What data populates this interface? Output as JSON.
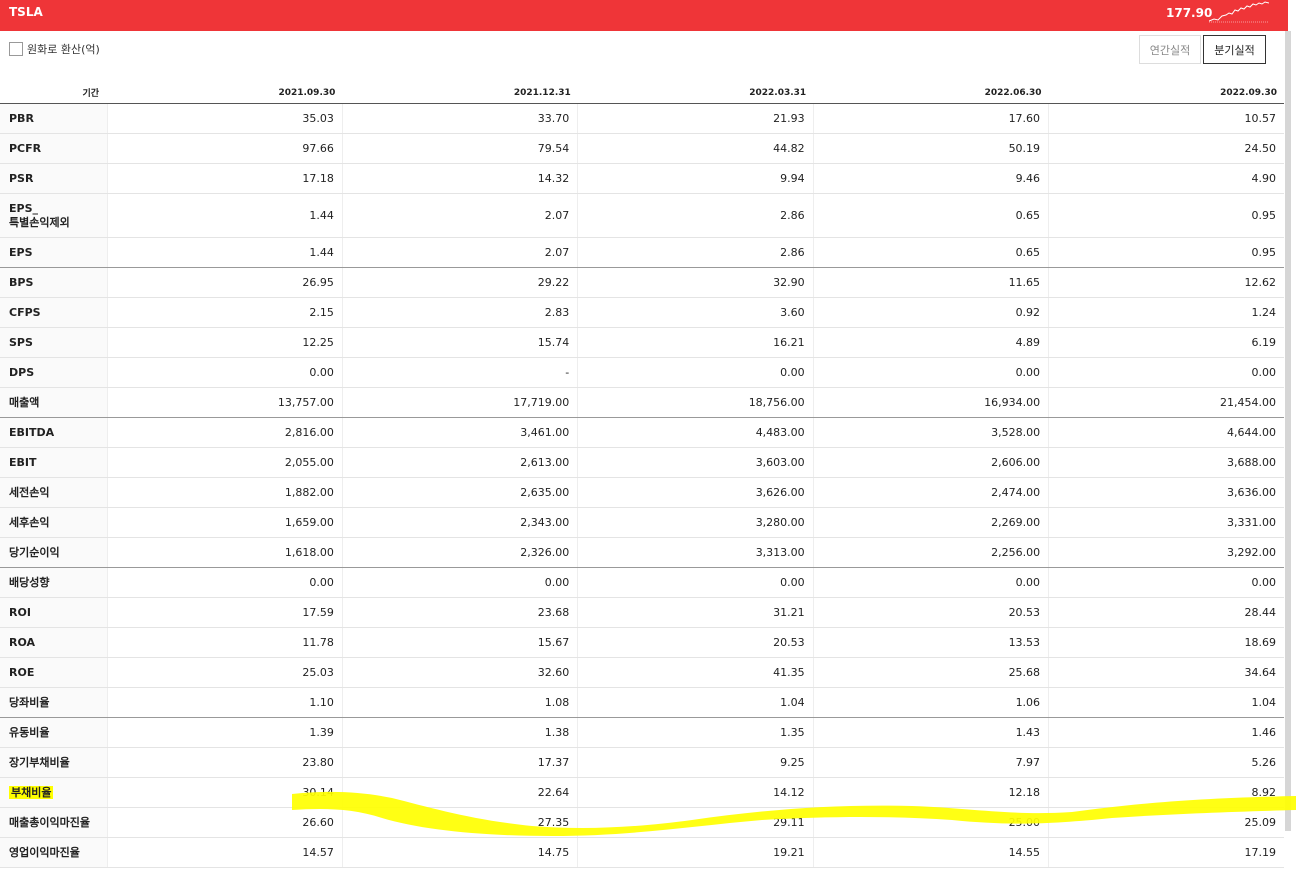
{
  "header": {
    "ticker": "TSLA",
    "price": "177.90"
  },
  "options": {
    "convert_label": "원화로 환산(억)"
  },
  "buttons": {
    "annual": "연간실적",
    "quarterly": "분기실적"
  },
  "colors": {
    "brand_bar": "#ef3538",
    "highlight": "#ffff00"
  },
  "table": {
    "period_label": "기간",
    "periods": [
      "2021.09.30",
      "2021.12.31",
      "2022.03.31",
      "2022.06.30",
      "2022.09.30"
    ],
    "rows": [
      {
        "label": "PBR",
        "values": [
          "35.03",
          "33.70",
          "21.93",
          "17.60",
          "10.57"
        ]
      },
      {
        "label": "PCFR",
        "values": [
          "97.66",
          "79.54",
          "44.82",
          "50.19",
          "24.50"
        ]
      },
      {
        "label": "PSR",
        "values": [
          "17.18",
          "14.32",
          "9.94",
          "9.46",
          "4.90"
        ]
      },
      {
        "label": "EPS_\n특별손익제외",
        "values": [
          "1.44",
          "2.07",
          "2.86",
          "0.65",
          "0.95"
        ]
      },
      {
        "label": "EPS",
        "values": [
          "1.44",
          "2.07",
          "2.86",
          "0.65",
          "0.95"
        ]
      },
      {
        "label": "BPS",
        "values": [
          "26.95",
          "29.22",
          "32.90",
          "11.65",
          "12.62"
        ]
      },
      {
        "label": "CFPS",
        "values": [
          "2.15",
          "2.83",
          "3.60",
          "0.92",
          "1.24"
        ]
      },
      {
        "label": "SPS",
        "values": [
          "12.25",
          "15.74",
          "16.21",
          "4.89",
          "6.19"
        ]
      },
      {
        "label": "DPS",
        "values": [
          "0.00",
          "-",
          "0.00",
          "0.00",
          "0.00"
        ]
      },
      {
        "label": "매출액",
        "values": [
          "13,757.00",
          "17,719.00",
          "18,756.00",
          "16,934.00",
          "21,454.00"
        ]
      },
      {
        "label": "EBITDA",
        "values": [
          "2,816.00",
          "3,461.00",
          "4,483.00",
          "3,528.00",
          "4,644.00"
        ]
      },
      {
        "label": "EBIT",
        "values": [
          "2,055.00",
          "2,613.00",
          "3,603.00",
          "2,606.00",
          "3,688.00"
        ]
      },
      {
        "label": "세전손익",
        "values": [
          "1,882.00",
          "2,635.00",
          "3,626.00",
          "2,474.00",
          "3,636.00"
        ]
      },
      {
        "label": "세후손익",
        "values": [
          "1,659.00",
          "2,343.00",
          "3,280.00",
          "2,269.00",
          "3,331.00"
        ]
      },
      {
        "label": "당기순이익",
        "values": [
          "1,618.00",
          "2,326.00",
          "3,313.00",
          "2,256.00",
          "3,292.00"
        ]
      },
      {
        "label": "배당성향",
        "values": [
          "0.00",
          "0.00",
          "0.00",
          "0.00",
          "0.00"
        ]
      },
      {
        "label": "ROI",
        "values": [
          "17.59",
          "23.68",
          "31.21",
          "20.53",
          "28.44"
        ]
      },
      {
        "label": "ROA",
        "values": [
          "11.78",
          "15.67",
          "20.53",
          "13.53",
          "18.69"
        ]
      },
      {
        "label": "ROE",
        "values": [
          "25.03",
          "32.60",
          "41.35",
          "25.68",
          "34.64"
        ]
      },
      {
        "label": "당좌비율",
        "values": [
          "1.10",
          "1.08",
          "1.04",
          "1.06",
          "1.04"
        ]
      },
      {
        "label": "유동비율",
        "values": [
          "1.39",
          "1.38",
          "1.35",
          "1.43",
          "1.46"
        ]
      },
      {
        "label": "장기부채비율",
        "values": [
          "23.80",
          "17.37",
          "9.25",
          "7.97",
          "5.26"
        ]
      },
      {
        "label": "부채비율",
        "values": [
          "30.14",
          "22.64",
          "14.12",
          "12.18",
          "8.92"
        ]
      },
      {
        "label": "매출총이익마진율",
        "values": [
          "26.60",
          "27.35",
          "29.11",
          "25.00",
          "25.09"
        ]
      },
      {
        "label": "영업이익마진율",
        "values": [
          "14.57",
          "14.75",
          "19.21",
          "14.55",
          "17.19"
        ]
      }
    ]
  }
}
